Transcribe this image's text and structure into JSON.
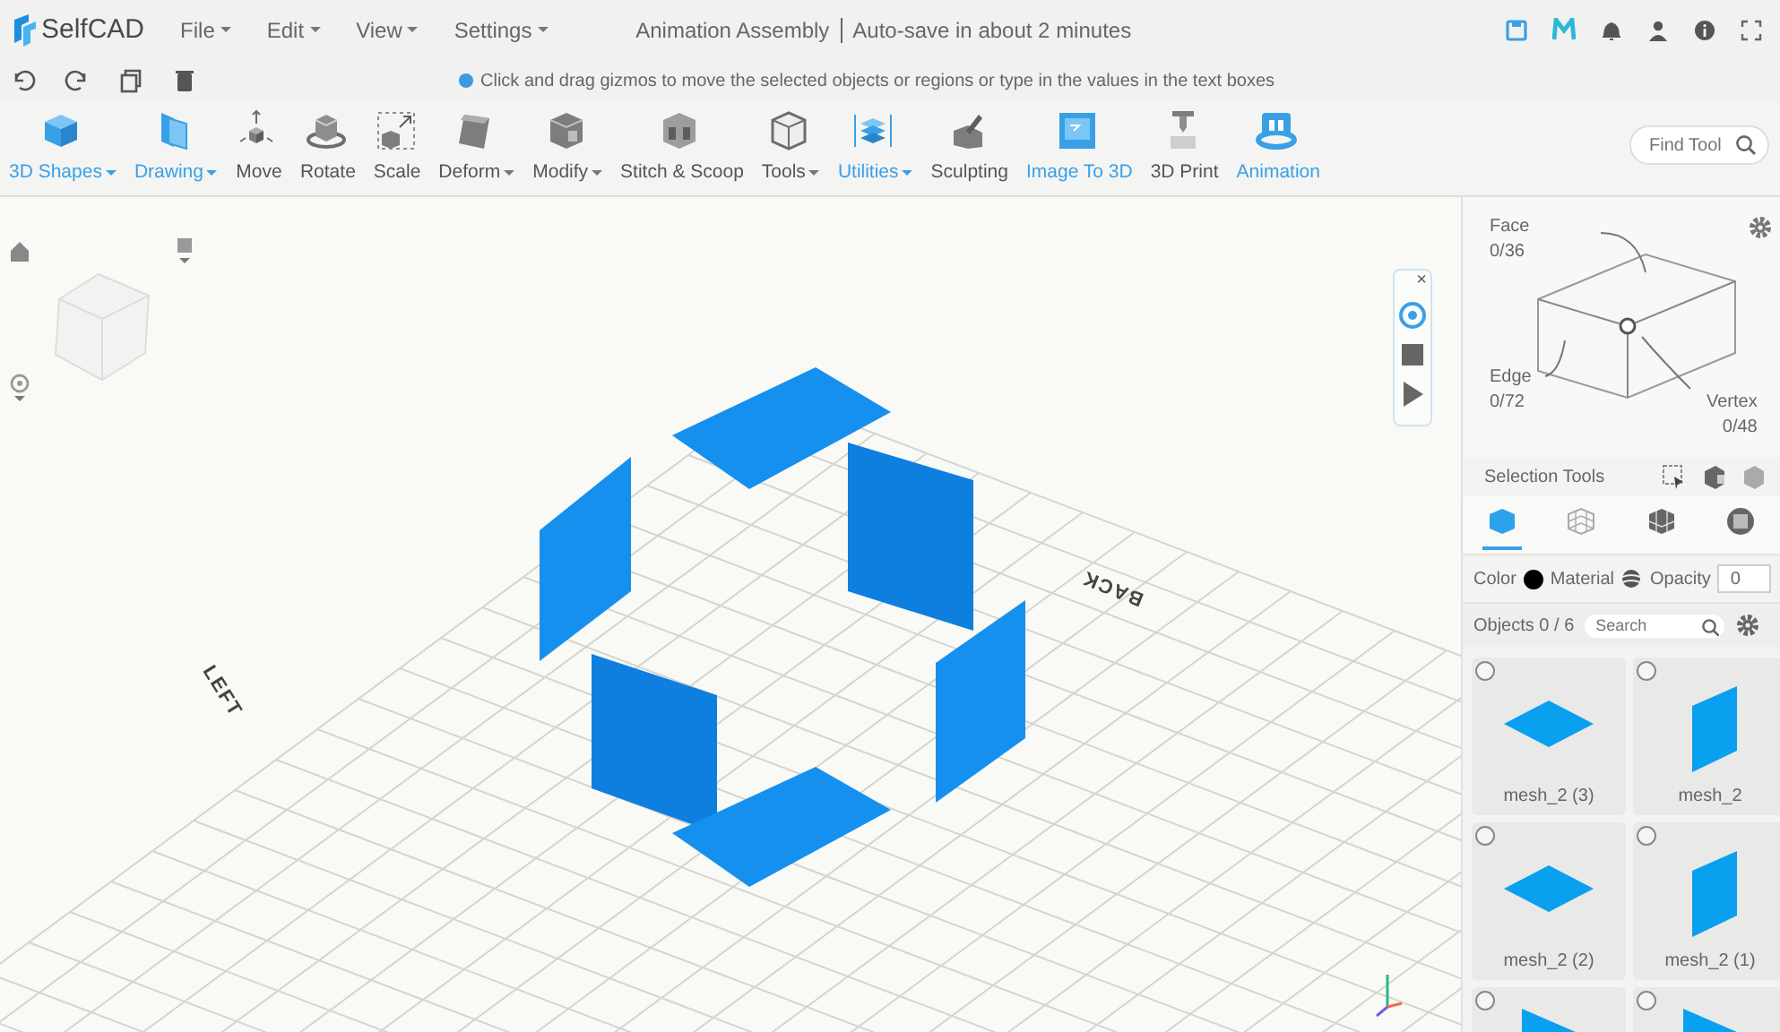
{
  "app": {
    "name": "SelfCAD"
  },
  "menu": [
    {
      "label": "File"
    },
    {
      "label": "Edit"
    },
    {
      "label": "View"
    },
    {
      "label": "Settings"
    }
  ],
  "document": {
    "title": "Animation Assembly",
    "autosave": "Auto-save in about 2 minutes"
  },
  "hint": "Click and drag gizmos to move the selected objects or regions or type in the values in the text boxes",
  "tools": [
    {
      "label": "3D Shapes",
      "active": true,
      "dropdown": true
    },
    {
      "label": "Drawing",
      "active": true,
      "dropdown": true
    },
    {
      "label": "Move",
      "active": false,
      "dropdown": false
    },
    {
      "label": "Rotate",
      "active": false,
      "dropdown": false
    },
    {
      "label": "Scale",
      "active": false,
      "dropdown": false
    },
    {
      "label": "Deform",
      "active": false,
      "dropdown": true
    },
    {
      "label": "Modify",
      "active": false,
      "dropdown": true
    },
    {
      "label": "Stitch & Scoop",
      "active": false,
      "dropdown": false
    },
    {
      "label": "Tools",
      "active": false,
      "dropdown": true
    },
    {
      "label": "Utilities",
      "active": true,
      "dropdown": true
    },
    {
      "label": "Sculpting",
      "active": false,
      "dropdown": false
    },
    {
      "label": "Image To 3D",
      "active": true,
      "dropdown": false
    },
    {
      "label": "3D Print",
      "active": false,
      "dropdown": false
    },
    {
      "label": "Animation",
      "active": true,
      "dropdown": false
    }
  ],
  "find_tool": {
    "placeholder": "Find Tool"
  },
  "viewport": {
    "axis_labels": [
      {
        "text": "LEFT",
        "kind": "left"
      },
      {
        "text": "BACK",
        "kind": "back"
      }
    ],
    "animation_controls": [
      {
        "kind": "record",
        "selected": true
      },
      {
        "kind": "stop",
        "selected": false
      },
      {
        "kind": "play",
        "selected": false
      }
    ],
    "close": "×"
  },
  "selection_panel": {
    "face": {
      "label": "Face",
      "count": "0/36"
    },
    "edge": {
      "label": "Edge",
      "count": "0/72"
    },
    "vertex": {
      "label": "Vertex",
      "count": "0/48"
    },
    "tools_label": "Selection Tools",
    "modes": [
      {
        "kind": "object",
        "selected": true
      },
      {
        "kind": "mesh",
        "selected": false
      },
      {
        "kind": "solid",
        "selected": false
      },
      {
        "kind": "face",
        "selected": false
      }
    ]
  },
  "properties": {
    "color_label": "Color",
    "color": "#000000",
    "material_label": "Material",
    "opacity_label": "Opacity",
    "opacity": "0"
  },
  "objects": {
    "label": "Objects 0 / 6",
    "search_placeholder": "Search",
    "items": [
      {
        "name": "mesh_2 (3)",
        "kind": "flat",
        "selected": false
      },
      {
        "name": "mesh_2",
        "kind": "upright",
        "selected": false
      },
      {
        "name": "mesh_2 (2)",
        "kind": "flat",
        "selected": false
      },
      {
        "name": "mesh_2 (1)",
        "kind": "upright",
        "selected": false
      },
      {
        "kind": "slanted",
        "selected": false
      },
      {
        "kind": "slanted",
        "selected": false
      }
    ]
  }
}
